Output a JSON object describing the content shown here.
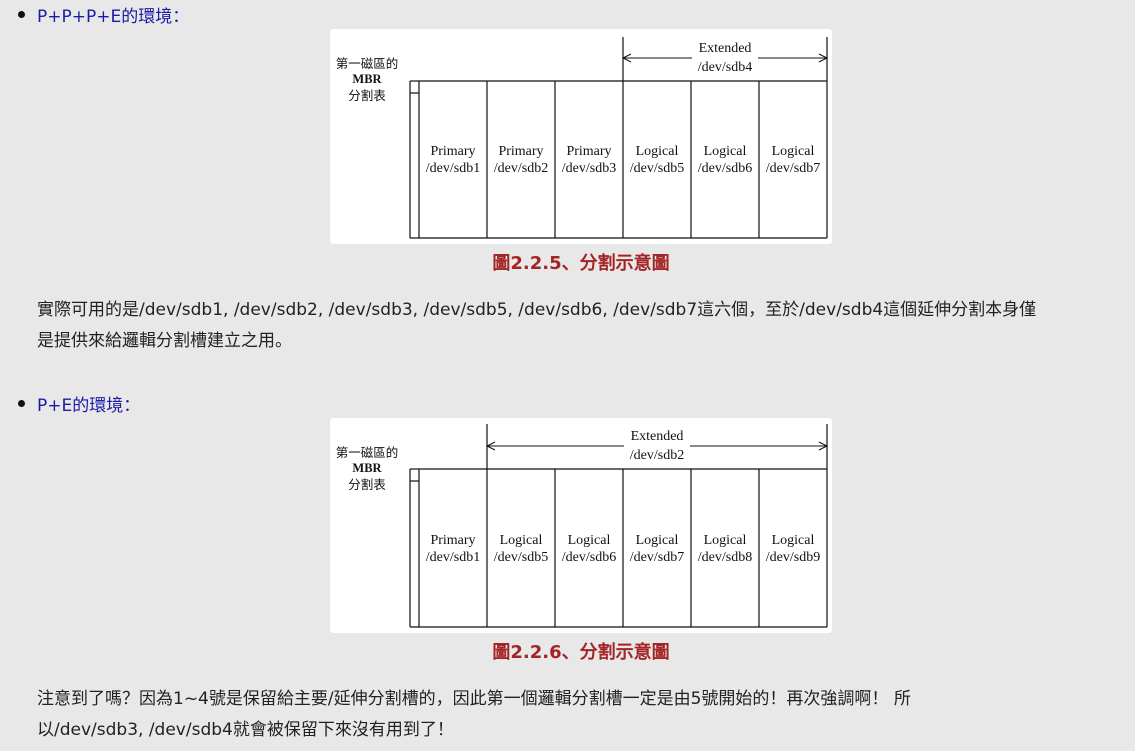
{
  "section1": {
    "heading": "P+P+P+E的環境：",
    "figure": {
      "mbr_label": [
        "第一磁區的",
        "MBR",
        "分割表"
      ],
      "extended_label": "Extended",
      "extended_device": "/dev/sdb4",
      "partitions": [
        {
          "type": "Primary",
          "device": "/dev/sdb1"
        },
        {
          "type": "Primary",
          "device": "/dev/sdb2"
        },
        {
          "type": "Primary",
          "device": "/dev/sdb3"
        },
        {
          "type": "Logical",
          "device": "/dev/sdb5"
        },
        {
          "type": "Logical",
          "device": "/dev/sdb6"
        },
        {
          "type": "Logical",
          "device": "/dev/sdb7"
        }
      ]
    },
    "caption": "圖2.2.5、分割示意圖",
    "text_line1": "實際可用的是/dev/sdb1, /dev/sdb2, /dev/sdb3, /dev/sdb5, /dev/sdb6, /dev/sdb7這六個，至於/dev/sdb4這個延伸分割本身僅",
    "text_line2": "是提供來給邏輯分割槽建立之用。"
  },
  "section2": {
    "heading": "P+E的環境：",
    "figure": {
      "mbr_label": [
        "第一磁區的",
        "MBR",
        "分割表"
      ],
      "extended_label": "Extended",
      "extended_device": "/dev/sdb2",
      "partitions": [
        {
          "type": "Primary",
          "device": "/dev/sdb1"
        },
        {
          "type": "Logical",
          "device": "/dev/sdb5"
        },
        {
          "type": "Logical",
          "device": "/dev/sdb6"
        },
        {
          "type": "Logical",
          "device": "/dev/sdb7"
        },
        {
          "type": "Logical",
          "device": "/dev/sdb8"
        },
        {
          "type": "Logical",
          "device": "/dev/sdb9"
        }
      ]
    },
    "caption": "圖2.2.6、分割示意圖",
    "text_line1": "注意到了嗎？因為1~4號是保留給主要/延伸分割槽的，因此第一個邏輯分割槽一定是由5號開始的！再次強調啊！ 所",
    "text_line2": "以/dev/sdb3, /dev/sdb4就會被保留下來沒有用到了！"
  }
}
